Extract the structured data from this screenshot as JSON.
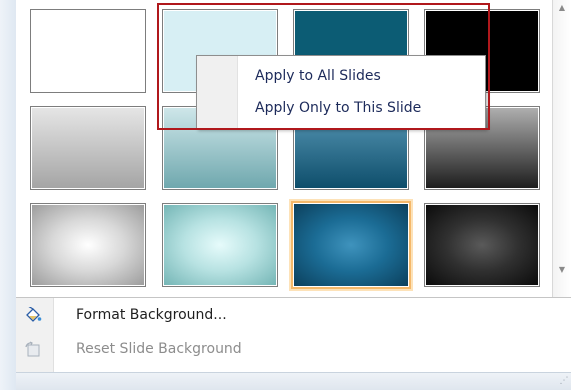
{
  "gallery": {
    "swatches": [
      {
        "row": 1,
        "col": 1,
        "style": "white",
        "name": "swatch-white"
      },
      {
        "row": 1,
        "col": 2,
        "style": "light-cyan",
        "name": "swatch-light-cyan"
      },
      {
        "row": 1,
        "col": 3,
        "style": "dark-teal",
        "name": "swatch-dark-teal"
      },
      {
        "row": 1,
        "col": 4,
        "style": "black",
        "name": "swatch-black"
      },
      {
        "row": 2,
        "col": 1,
        "style": "gray-linear-gradient",
        "name": "swatch-gray-linear"
      },
      {
        "row": 2,
        "col": 2,
        "style": "teal-linear-gradient",
        "name": "swatch-teal-linear"
      },
      {
        "row": 2,
        "col": 3,
        "style": "blue-linear-gradient",
        "name": "swatch-blue-linear"
      },
      {
        "row": 2,
        "col": 4,
        "style": "dark-gray-linear-gradient",
        "name": "swatch-dark-gray-linear"
      },
      {
        "row": 3,
        "col": 1,
        "style": "gray-radial-gradient",
        "name": "swatch-gray-radial"
      },
      {
        "row": 3,
        "col": 2,
        "style": "teal-radial-gradient",
        "name": "swatch-teal-radial"
      },
      {
        "row": 3,
        "col": 3,
        "style": "blue-radial-gradient",
        "name": "swatch-blue-radial",
        "selected": true
      },
      {
        "row": 3,
        "col": 4,
        "style": "black-radial-gradient",
        "name": "swatch-black-radial"
      }
    ]
  },
  "context_menu": {
    "items": [
      {
        "label": "Apply to All Slides"
      },
      {
        "label": "Apply Only to This Slide"
      }
    ]
  },
  "menu": {
    "format_background": {
      "label": "Format Background...",
      "icon": "paint-bucket-icon",
      "enabled": true
    },
    "reset_background": {
      "label": "Reset Slide Background",
      "icon": "reset-background-icon",
      "enabled": false
    }
  },
  "colors": {
    "highlight_border": "#b0181c",
    "selection_border": "#f5b86a",
    "menu_text": "#1c2a5a",
    "disabled_text": "#8d8d8d"
  }
}
